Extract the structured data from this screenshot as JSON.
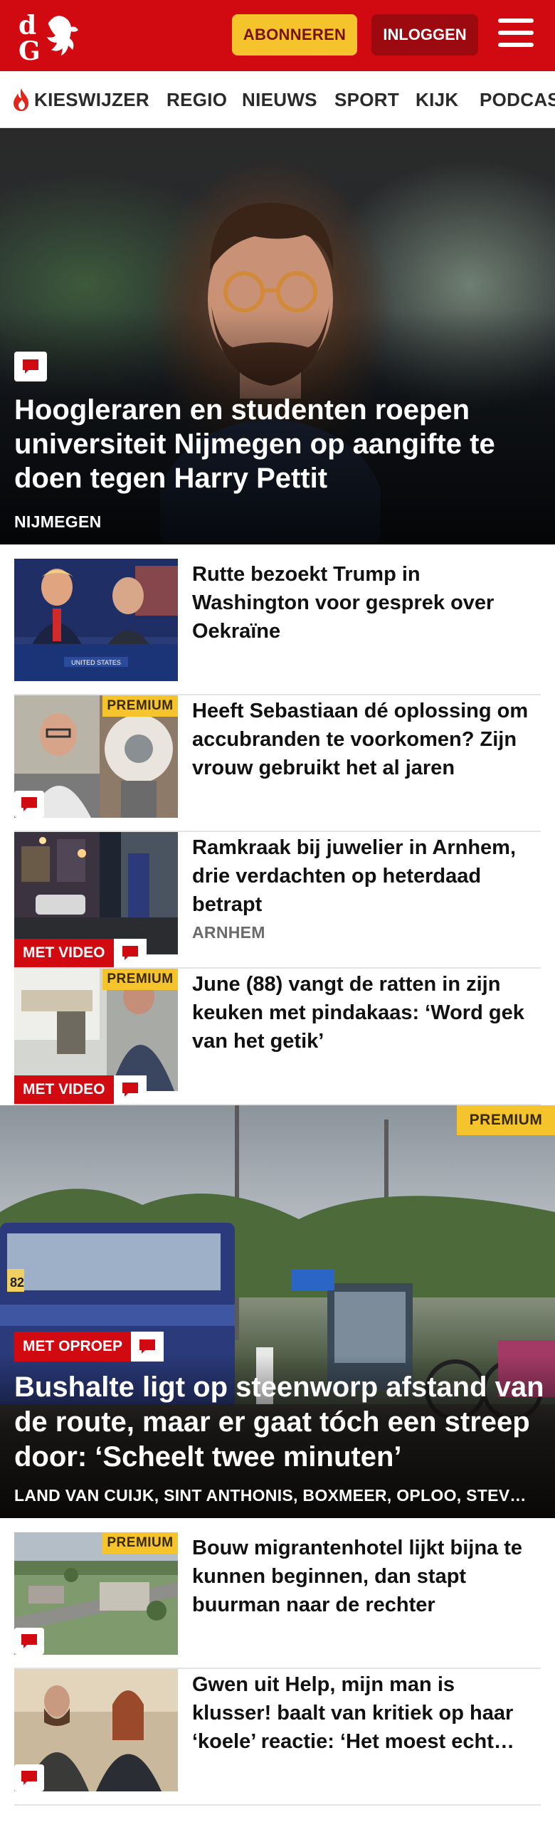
{
  "header": {
    "logo_text": "dG",
    "subscribe_label": "ABONNEREN",
    "login_label": "INLOGGEN"
  },
  "nav": {
    "items": [
      {
        "label": "KIESWIJZER",
        "icon": "flame-icon"
      },
      {
        "label": "REGIO"
      },
      {
        "label": "NIEUWS"
      },
      {
        "label": "SPORT"
      },
      {
        "label": "KIJK"
      },
      {
        "label": "PODCAS"
      }
    ]
  },
  "hero": {
    "title": "Hoogleraren en studenten roepen universiteit Nijmegen op aangifte te doen tegen Harry Pettit",
    "tag": "NIJMEGEN",
    "has_comments": true
  },
  "articles": [
    {
      "title": "Rutte bezoekt Trump in Washington voor gesprek over Oekraïne",
      "tag": "",
      "premium": false,
      "video": false,
      "comments": false
    },
    {
      "title": "Heeft Sebastiaan dé oplossing om accubranden te voorkomen? Zijn vrouw gebruikt het al jaren",
      "tag": "",
      "premium": true,
      "video": false,
      "comments": true
    },
    {
      "title": "Ramkraak bij juwelier in Arnhem, drie verdachten op heterdaad betrapt",
      "tag": "ARNHEM",
      "premium": false,
      "video": true,
      "comments": true
    },
    {
      "title": "June (88) vangt de ratten in zijn keuken met pindakaas: ‘Word gek van het getik’",
      "tag": "",
      "premium": true,
      "video": true,
      "comments": true
    }
  ],
  "feature": {
    "title": "Bushalte ligt op steenworp afstand van de route, maar er gaat tóch een streep door: ‘Scheelt twee minuten’",
    "tag": "LAND VAN CUIJK, SINT ANTHONIS, BOXMEER, OPLOO, STEV…",
    "premium": true,
    "oproep_label": "MET OPROEP",
    "bus_number": "82"
  },
  "articles_2": [
    {
      "title": "Bouw migrantenhotel lijkt bijna te kunnen beginnen, dan stapt buurman naar de rechter",
      "premium": true,
      "comments": true
    },
    {
      "title": "Gwen uit Help, mijn man is klusser! baalt van kritiek op haar ‘koele’ reactie: ‘Het moest echt…",
      "premium": false,
      "comments": true
    }
  ],
  "labels": {
    "premium": "PREMIUM",
    "video": "MET VIDEO"
  },
  "colors": {
    "brand_red": "#d10a11",
    "premium_yellow": "#f5c42c",
    "login_dark_red": "#9c0a10"
  }
}
